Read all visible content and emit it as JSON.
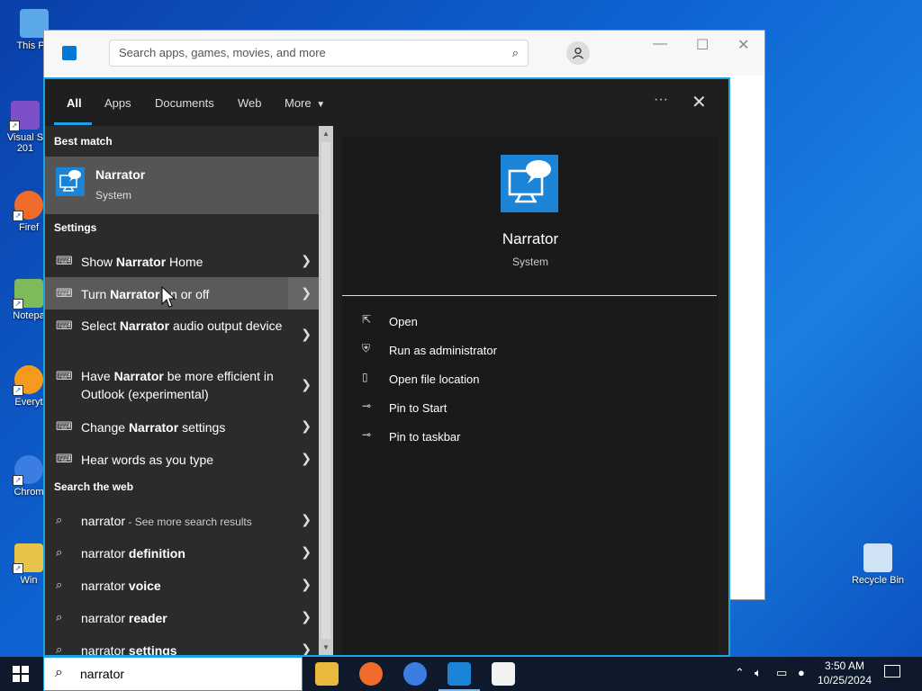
{
  "desktop": {
    "icons": [
      {
        "label": "This PC"
      },
      {
        "label": "Visual S 201"
      },
      {
        "label": "Firef"
      },
      {
        "label": "Notepa"
      },
      {
        "label": "Everyt"
      },
      {
        "label": "Chrom"
      },
      {
        "label": "Win"
      }
    ],
    "recycle_bin": "Recycle Bin"
  },
  "store_window": {
    "search_placeholder": "Search apps, games, movies, and more"
  },
  "search_panel": {
    "tabs": [
      "All",
      "Apps",
      "Documents",
      "Web",
      "More"
    ],
    "best_match_heading": "Best match",
    "best_match": {
      "title": "Narrator",
      "subtitle": "System"
    },
    "settings_heading": "Settings",
    "settings_items": [
      {
        "pre": "Show ",
        "bold": "Narrator",
        "post": " Home"
      },
      {
        "pre": "Turn ",
        "bold": "Narrator",
        "post": " on or off"
      },
      {
        "pre": "Select ",
        "bold": "Narrator",
        "post": " audio output device"
      },
      {
        "pre": "Have ",
        "bold": "Narrator",
        "post": " be more efficient in Outlook (experimental)"
      },
      {
        "pre": "Change ",
        "bold": "Narrator",
        "post": " settings"
      },
      {
        "pre": "Hear words as you type",
        "bold": "",
        "post": ""
      }
    ],
    "web_heading": "Search the web",
    "web_items": [
      {
        "pre": "narrator",
        "bold": "",
        "muted": " - See more search results"
      },
      {
        "pre": "narrator ",
        "bold": "definition",
        "muted": ""
      },
      {
        "pre": "narrator ",
        "bold": "voice",
        "muted": ""
      },
      {
        "pre": "narrator ",
        "bold": "reader",
        "muted": ""
      },
      {
        "pre": "narrator ",
        "bold": "settings",
        "muted": ""
      }
    ],
    "preview": {
      "name": "Narrator",
      "type": "System",
      "actions": [
        "Open",
        "Run as administrator",
        "Open file location",
        "Pin to Start",
        "Pin to taskbar"
      ]
    }
  },
  "taskbar": {
    "search_value": "narrator",
    "time": "3:50 AM",
    "date": "10/25/2024"
  },
  "colors": {
    "accent": "#1aa3e8",
    "narrator_blue": "#1b84d6",
    "panel_bg": "#1f1f1f",
    "taskbar_bg": "#0e1a2b"
  }
}
